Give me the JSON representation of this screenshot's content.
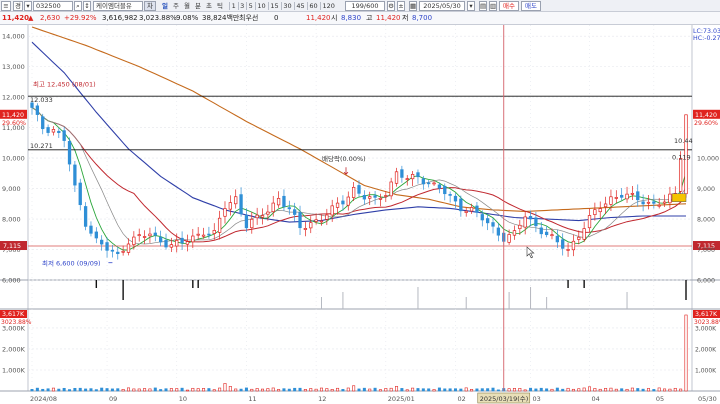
{
  "toolbar": {
    "mode_select": "경",
    "code_input": "032500",
    "stock_name": "케이엠더블유",
    "chart_type_box": "차",
    "periods": [
      {
        "label": "일",
        "active": true
      },
      {
        "label": "주",
        "active": false
      },
      {
        "label": "월",
        "active": false
      },
      {
        "label": "분",
        "active": false
      },
      {
        "label": "초",
        "active": false
      },
      {
        "label": "틱",
        "active": false
      }
    ],
    "minute_options": [
      "1",
      "3",
      "5",
      "10",
      "15",
      "30",
      "45",
      "60",
      "120"
    ],
    "count_field": "199/600",
    "date_field": "2025/05/30",
    "buy_label": "매수",
    "sell_label": "매도"
  },
  "quote": {
    "price": "11,420",
    "change": "2,630",
    "change_pct": "+29.92%",
    "volume": "3,616,982",
    "volume_pct": "3,023.88%",
    "turnover": "9.08%",
    "amount": "38,824백만",
    "min_trade_label": "최우선",
    "min_trade_value": "0",
    "current_value": "11,420",
    "open_label": "시",
    "open_value": "8,830",
    "high_label": "고",
    "high_value": "11,420",
    "low_label": "저",
    "low_value": "8,700"
  },
  "colors": {
    "up": "#e0231f",
    "down": "#2f8fd6",
    "ma5": "#2aa63a",
    "ma20": "#c0282f",
    "ma60": "#2f3fa8",
    "ma120": "#c56a1c",
    "grid": "#e4e6ec"
  },
  "chart_data": [
    {
      "type": "candlestick",
      "x_labels": [
        "2024/08",
        "09",
        "10",
        "11",
        "12",
        "2025/01",
        "02",
        "03",
        "04",
        "05",
        "05/30"
      ],
      "y_ticks": [
        "14,000",
        "13,000",
        "12,000",
        "11,000",
        "10,000",
        "9,000",
        "8,000",
        "7,000",
        "6,000"
      ],
      "ylim": [
        6000,
        14300
      ],
      "annotations": {
        "high_label": "최고 12,450 (08/01)",
        "low_label": "최저 6,600 (09/09)",
        "event_label": "배당락(0.00%)",
        "left_label_1": "12.033",
        "left_label_2": "10.271",
        "right_label": "10.44",
        "right_label_2": "0.119",
        "hline_1": 12030,
        "hline_2": 10271,
        "price_line": 7115
      },
      "right_axis": {
        "ma_tag": "LC:73.03",
        "ma_tag_2": "HC:-0.27",
        "price_tag": "11,420",
        "pct_tag": "29.60%",
        "pct_tag_2": "29.60%",
        "base_tag": "7,115"
      },
      "left_axis": {
        "price_tag": "11,420",
        "pct_tag": "29.60%",
        "base_tag": "7,115"
      },
      "crosshair_date": "2025/03/19(수)",
      "close_anchors": [
        [
          0,
          11600
        ],
        [
          2,
          11000
        ],
        [
          4,
          10950
        ],
        [
          6,
          10600
        ],
        [
          8,
          9000
        ],
        [
          10,
          7900
        ],
        [
          12,
          7300
        ],
        [
          14,
          7000
        ],
        [
          16,
          6800
        ],
        [
          18,
          7300
        ],
        [
          20,
          7400
        ],
        [
          22,
          7500
        ],
        [
          24,
          7300
        ],
        [
          26,
          7150
        ],
        [
          28,
          7200
        ],
        [
          30,
          7400
        ],
        [
          32,
          7600
        ],
        [
          34,
          7500
        ],
        [
          36,
          8400
        ],
        [
          38,
          8700
        ],
        [
          40,
          7800
        ],
        [
          42,
          8000
        ],
        [
          44,
          8300
        ],
        [
          46,
          8700
        ],
        [
          48,
          8300
        ],
        [
          50,
          7700
        ],
        [
          52,
          7900
        ],
        [
          54,
          8000
        ],
        [
          56,
          8300
        ],
        [
          58,
          8600
        ],
        [
          60,
          9000
        ],
        [
          62,
          8700
        ],
        [
          64,
          8600
        ],
        [
          66,
          8900
        ],
        [
          68,
          9500
        ],
        [
          70,
          9300
        ],
        [
          72,
          9400
        ],
        [
          74,
          9200
        ],
        [
          76,
          9000
        ],
        [
          78,
          8700
        ],
        [
          80,
          8400
        ],
        [
          82,
          8300
        ],
        [
          84,
          8000
        ],
        [
          86,
          7700
        ],
        [
          88,
          7400
        ],
        [
          90,
          7500
        ],
        [
          92,
          8100
        ],
        [
          94,
          7800
        ],
        [
          96,
          7500
        ],
        [
          98,
          7200
        ],
        [
          100,
          7000
        ],
        [
          102,
          7500
        ],
        [
          104,
          8000
        ],
        [
          106,
          8400
        ],
        [
          108,
          8700
        ],
        [
          110,
          8800
        ],
        [
          112,
          8700
        ],
        [
          114,
          8600
        ],
        [
          116,
          8500
        ],
        [
          118,
          8550
        ],
        [
          120,
          8800
        ],
        [
          122,
          11420
        ]
      ],
      "ma_anchors": {
        "ma60": [
          [
            0,
            13800
          ],
          [
            6,
            12800
          ],
          [
            12,
            11500
          ],
          [
            18,
            10300
          ],
          [
            24,
            9400
          ],
          [
            30,
            8700
          ],
          [
            36,
            8300
          ],
          [
            42,
            8050
          ],
          [
            48,
            7900
          ],
          [
            54,
            7950
          ],
          [
            60,
            8150
          ],
          [
            66,
            8300
          ],
          [
            72,
            8400
          ],
          [
            78,
            8350
          ],
          [
            84,
            8200
          ],
          [
            90,
            8050
          ],
          [
            96,
            8000
          ],
          [
            102,
            7950
          ],
          [
            108,
            8050
          ],
          [
            114,
            8100
          ],
          [
            122,
            8100
          ]
        ],
        "ma120": [
          [
            0,
            14300
          ],
          [
            10,
            13700
          ],
          [
            20,
            13000
          ],
          [
            30,
            12200
          ],
          [
            40,
            11200
          ],
          [
            50,
            10300
          ],
          [
            56,
            9700
          ],
          [
            62,
            9100
          ],
          [
            68,
            8800
          ],
          [
            74,
            8650
          ],
          [
            80,
            8400
          ],
          [
            86,
            8300
          ],
          [
            92,
            8250
          ],
          [
            98,
            8300
          ],
          [
            104,
            8350
          ],
          [
            110,
            8400
          ],
          [
            116,
            8450
          ],
          [
            122,
            8500
          ]
        ]
      }
    },
    {
      "type": "bar",
      "name": "signal",
      "description_hidden": false
    },
    {
      "type": "bar",
      "y_ticks": [
        "3,000K",
        "2,000K",
        "1,000K"
      ],
      "ylim": [
        0,
        3617
      ],
      "tags": {
        "left_value": "3,617K",
        "left_pct": "3023.88%",
        "right_value": "3,617K",
        "right_pct": "3023.88%"
      },
      "last_volume_k": 3617
    }
  ]
}
